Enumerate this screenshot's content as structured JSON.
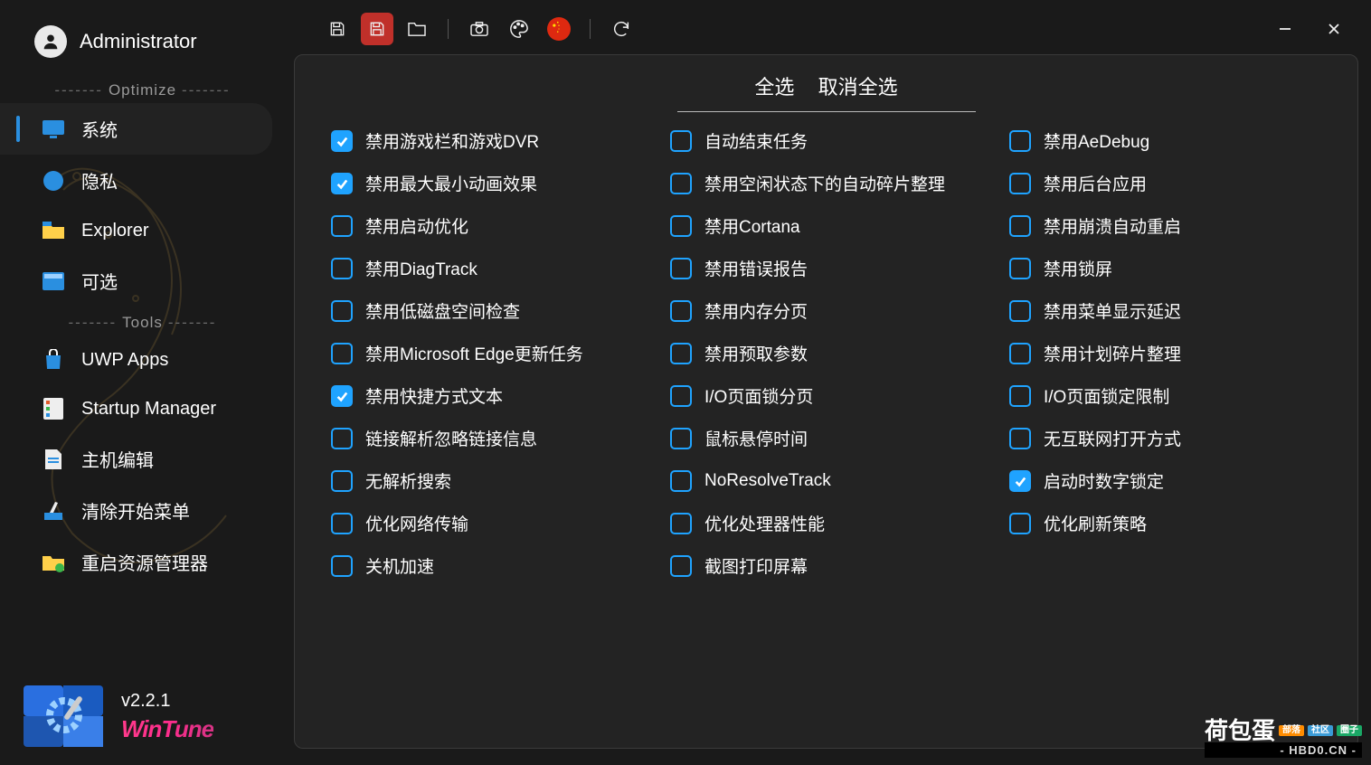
{
  "user": {
    "name": "Administrator"
  },
  "sections": {
    "optimize": "Optimize",
    "tools": "Tools"
  },
  "nav": {
    "system": "系统",
    "privacy": "隐私",
    "explorer": "Explorer",
    "optional": "可选",
    "uwp": "UWP Apps",
    "startup": "Startup Manager",
    "hostedit": "主机编辑",
    "clearstart": "清除开始菜单",
    "restartexplorer": "重启资源管理器"
  },
  "version": "v2.2.1",
  "brand": "WinTune",
  "actions": {
    "select_all": "全选",
    "deselect_all": "取消全选"
  },
  "options": [
    {
      "label": "禁用游戏栏和游戏DVR",
      "checked": true
    },
    {
      "label": "自动结束任务",
      "checked": false
    },
    {
      "label": "禁用AeDebug",
      "checked": false
    },
    {
      "label": "禁用最大最小动画效果",
      "checked": true
    },
    {
      "label": "禁用空闲状态下的自动碎片整理",
      "checked": false
    },
    {
      "label": "禁用后台应用",
      "checked": false
    },
    {
      "label": "禁用启动优化",
      "checked": false
    },
    {
      "label": "禁用Cortana",
      "checked": false
    },
    {
      "label": "禁用崩溃自动重启",
      "checked": false
    },
    {
      "label": "禁用DiagTrack",
      "checked": false
    },
    {
      "label": "禁用错误报告",
      "checked": false
    },
    {
      "label": "禁用锁屏",
      "checked": false
    },
    {
      "label": "禁用低磁盘空间检查",
      "checked": false
    },
    {
      "label": "禁用内存分页",
      "checked": false
    },
    {
      "label": "禁用菜单显示延迟",
      "checked": false
    },
    {
      "label": "禁用Microsoft Edge更新任务",
      "checked": false
    },
    {
      "label": "禁用预取参数",
      "checked": false
    },
    {
      "label": "禁用计划碎片整理",
      "checked": false
    },
    {
      "label": "禁用快捷方式文本",
      "checked": true
    },
    {
      "label": "I/O页面锁分页",
      "checked": false
    },
    {
      "label": "I/O页面锁定限制",
      "checked": false
    },
    {
      "label": "链接解析忽略链接信息",
      "checked": false
    },
    {
      "label": "鼠标悬停时间",
      "checked": false
    },
    {
      "label": "无互联网打开方式",
      "checked": false
    },
    {
      "label": "无解析搜索",
      "checked": false
    },
    {
      "label": "NoResolveTrack",
      "checked": false
    },
    {
      "label": "启动时数字锁定",
      "checked": true
    },
    {
      "label": "优化网络传输",
      "checked": false
    },
    {
      "label": "优化处理器性能",
      "checked": false
    },
    {
      "label": "优化刷新策略",
      "checked": false
    },
    {
      "label": "关机加速",
      "checked": false
    },
    {
      "label": "截图打印屏幕",
      "checked": false
    }
  ],
  "watermark": {
    "name": "荷包蛋",
    "badges": [
      "部落",
      "社区",
      "圈子"
    ],
    "url": "- HBD0.CN -"
  }
}
